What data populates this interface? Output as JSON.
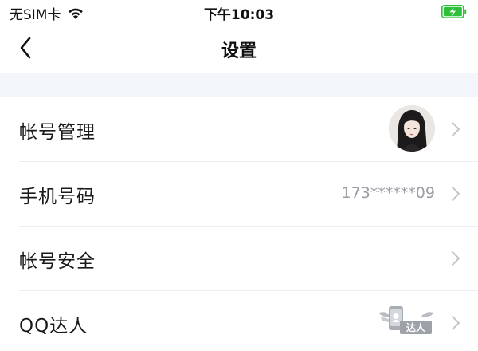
{
  "status_bar": {
    "carrier": "无SIM卡",
    "time": "下午10:03",
    "battery_color": "#2fbf3a"
  },
  "nav": {
    "title": "设置",
    "back_icon": "chevron-left-icon"
  },
  "settings": {
    "items": [
      {
        "label": "帐号管理",
        "value": "",
        "trailing": "avatar"
      },
      {
        "label": "手机号码",
        "value": "173******09",
        "trailing": "text"
      },
      {
        "label": "帐号安全",
        "value": "",
        "trailing": "none"
      },
      {
        "label": "QQ达人",
        "value": "",
        "trailing": "badge",
        "badge_text": "达人"
      }
    ]
  },
  "colors": {
    "separator_band": "#f2f5fa",
    "value_text": "#9a9da3",
    "chevron": "#c3c6cc"
  }
}
